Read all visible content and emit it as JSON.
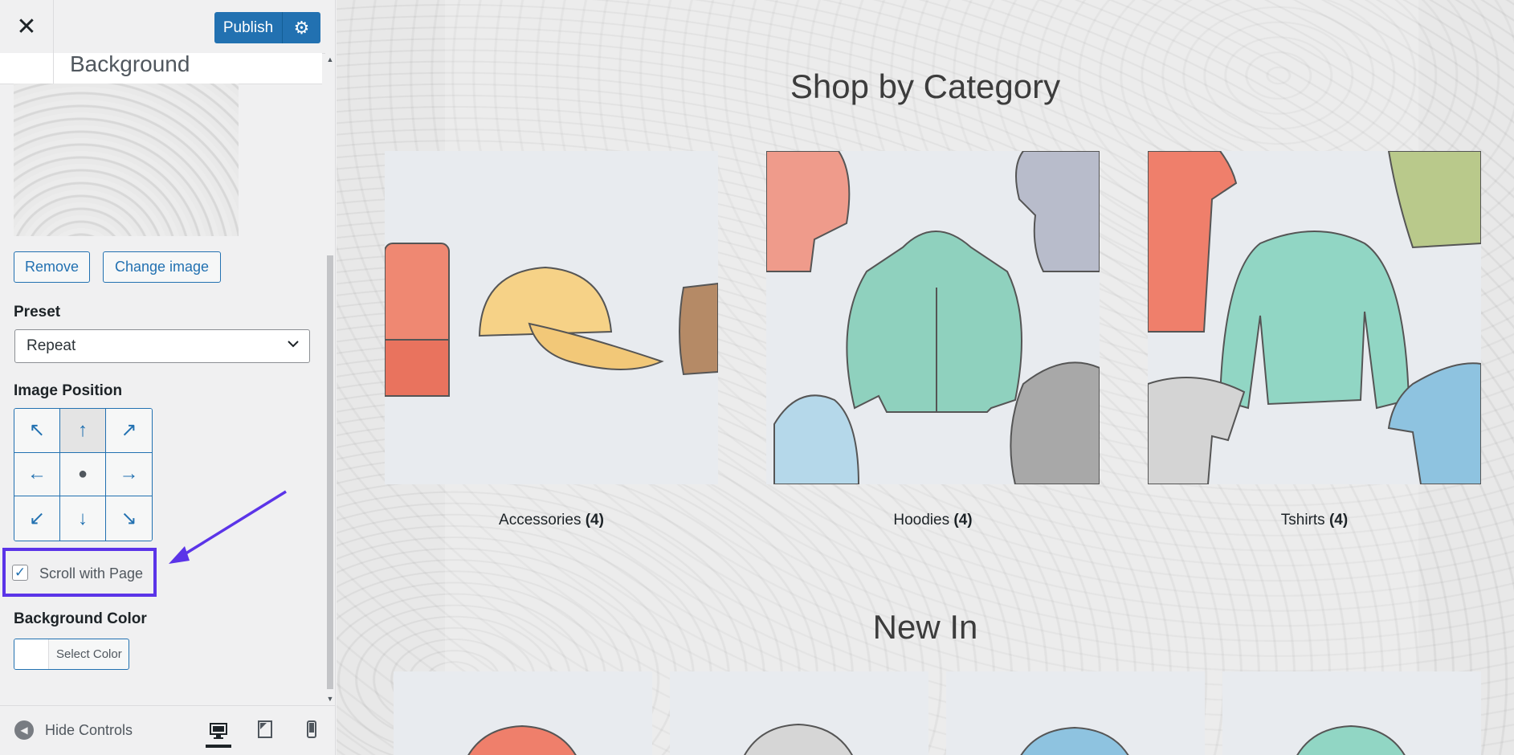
{
  "customizer": {
    "publish_label": "Publish",
    "section_title": "Background",
    "remove_label": "Remove",
    "change_image_label": "Change image",
    "preset_label": "Preset",
    "preset_value": "Repeat",
    "image_position_label": "Image Position",
    "position_grid": [
      "↖",
      "↑",
      "↗",
      "←",
      "●",
      "→",
      "↙",
      "↓",
      "↘"
    ],
    "scroll_with_page_label": "Scroll with Page",
    "scroll_with_page_checked": true,
    "background_color_label": "Background Color",
    "select_color_label": "Select Color",
    "hide_controls_label": "Hide Controls"
  },
  "preview": {
    "shop_heading": "Shop by Category",
    "categories": [
      {
        "name": "Accessories",
        "count": "(4)"
      },
      {
        "name": "Hoodies",
        "count": "(4)"
      },
      {
        "name": "Tshirts",
        "count": "(4)"
      }
    ],
    "new_heading": "New In"
  },
  "colors": {
    "accent": "#2271b1",
    "annotation": "#5b34e8"
  }
}
